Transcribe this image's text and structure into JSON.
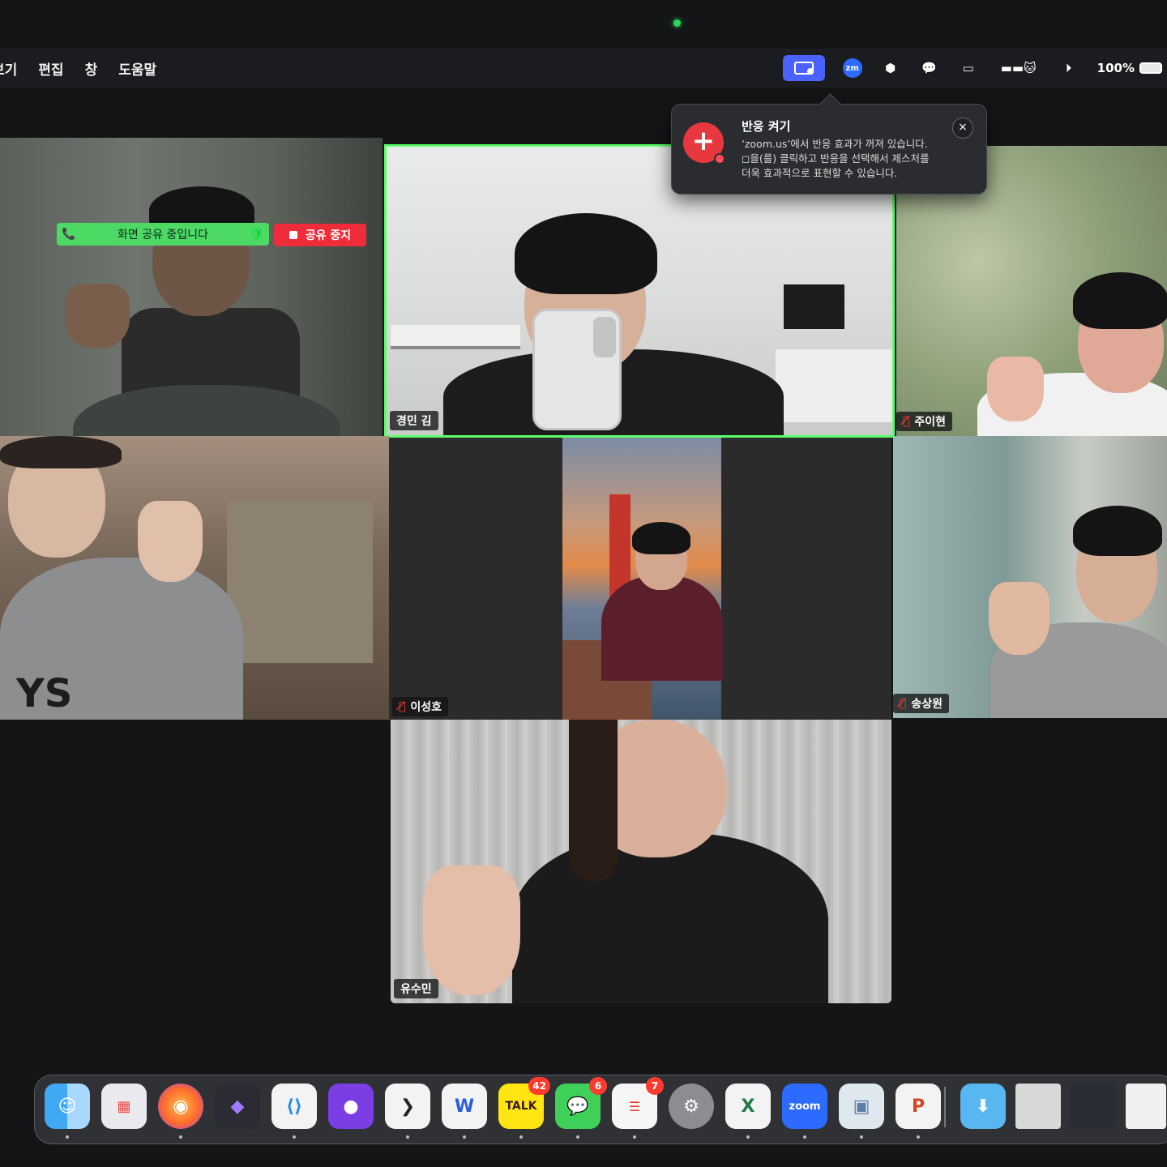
{
  "menubar": {
    "items": [
      "보기",
      "편집",
      "창",
      "도움말"
    ],
    "battery": "100%"
  },
  "popover": {
    "title": "반응 켜기",
    "line1": "‘zoom.us’에서 반응 효과가 꺼져 있습니다.",
    "line2": "◻을(를) 클릭하고 반응을 선택해서 제스처를",
    "line3": "더욱 효과적으로 표현할 수 있습니다.",
    "close": "×"
  },
  "share": {
    "banner": "화면 공유 중입니다",
    "stop": "공유 중지"
  },
  "participants": {
    "p2": "경민 김",
    "p3": "주이현",
    "p5": "이성호",
    "p6": "송상원",
    "p7": "유수민"
  },
  "dock": {
    "kakao_badge": "42",
    "messages_badge": "6",
    "reminders_badge": "7",
    "word": "W",
    "excel": "X",
    "zoom": "zoom",
    "ppt": "P",
    "talk": "TALK"
  },
  "colors": {
    "active_speaker": "#5cff6a",
    "share_green": "#4cd964",
    "stop_red": "#ef2d3a",
    "popover_bg": "#2b2c30"
  }
}
